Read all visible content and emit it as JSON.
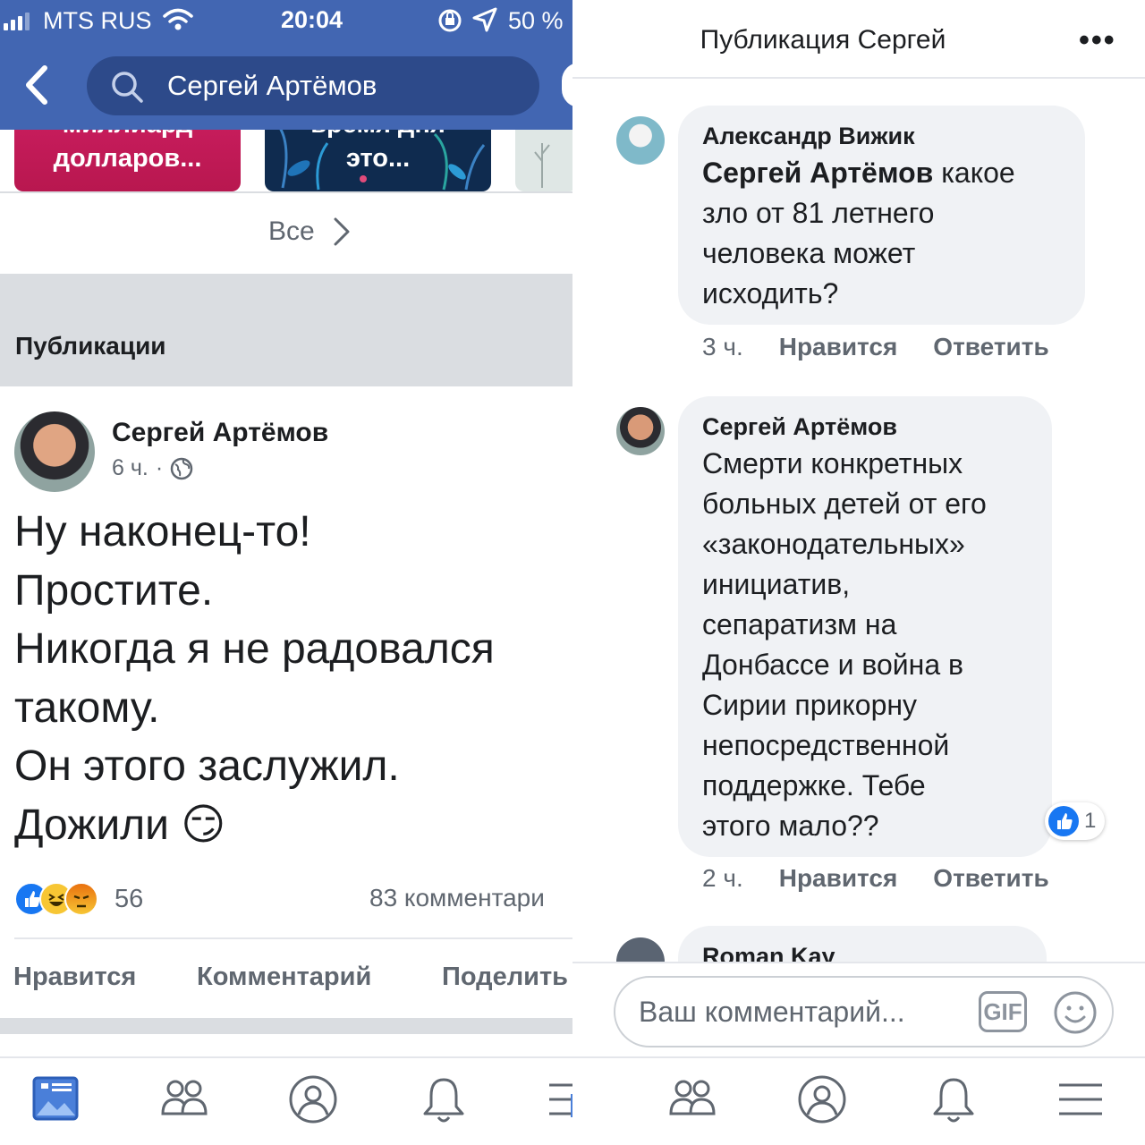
{
  "status": {
    "carrier": "MTS RUS",
    "time": "20:04",
    "battery": "50 %"
  },
  "search": {
    "query": "Сергей Артёмов"
  },
  "tiles": [
    {
      "text_line1": "миллиард",
      "text_line2": "долларов...",
      "color": "#cf1f63"
    },
    {
      "text_line1": "время дня",
      "text_line2": "это...",
      "color": "#0f2b4f"
    },
    {
      "text_line1": "",
      "text_line2": "",
      "color": "#dfe7e5"
    }
  ],
  "see_all": "Все",
  "section_title": "Публикации",
  "post": {
    "author": "Сергей Артёмов",
    "time": "6 ч.",
    "separator": "·",
    "text": "Ну наконец-то!\nПростите.\nНикогда я не радовался\nтакому.\nОн этого заслужил.\nДожили 😏",
    "reactions_count": "56",
    "comments_count": "83 комментари",
    "actions": {
      "like": "Нравится",
      "comment": "Комментарий",
      "share": "Поделить"
    }
  },
  "left_tabs": [
    "news-feed",
    "friends",
    "profile",
    "notifications",
    "menu"
  ],
  "right_header": {
    "title": "Публикация Сергей",
    "more": "•••"
  },
  "comments": [
    {
      "author": "Александр Вижик",
      "mention": "Сергей Артёмов",
      "text": " какое\nзло от 81 летнего\nчеловека может\nисходить?",
      "time": "3 ч.",
      "like": "Нравится",
      "reply": "Ответить"
    },
    {
      "author": "Сергей Артёмов",
      "text": "Смерти конкретных\nбольных детей от его\n«законодательных»\nинициатив,\nсепаратизм на\nДонбассе и война в\nСирии прикорну\nнепосредственной\nподдержке. Тебе\nэтого мало??",
      "time": "2 ч.",
      "like": "Нравится",
      "reply": "Ответить",
      "likes_count": "1"
    },
    {
      "author": "Roman Kay"
    }
  ],
  "composer": {
    "placeholder": "Ваш комментарий...",
    "gif": "GIF"
  },
  "colors": {
    "brand_blue": "#4266b2",
    "like_blue": "#1877f2",
    "bubble_gray": "#f0f2f5",
    "secondary_text": "#606770"
  }
}
